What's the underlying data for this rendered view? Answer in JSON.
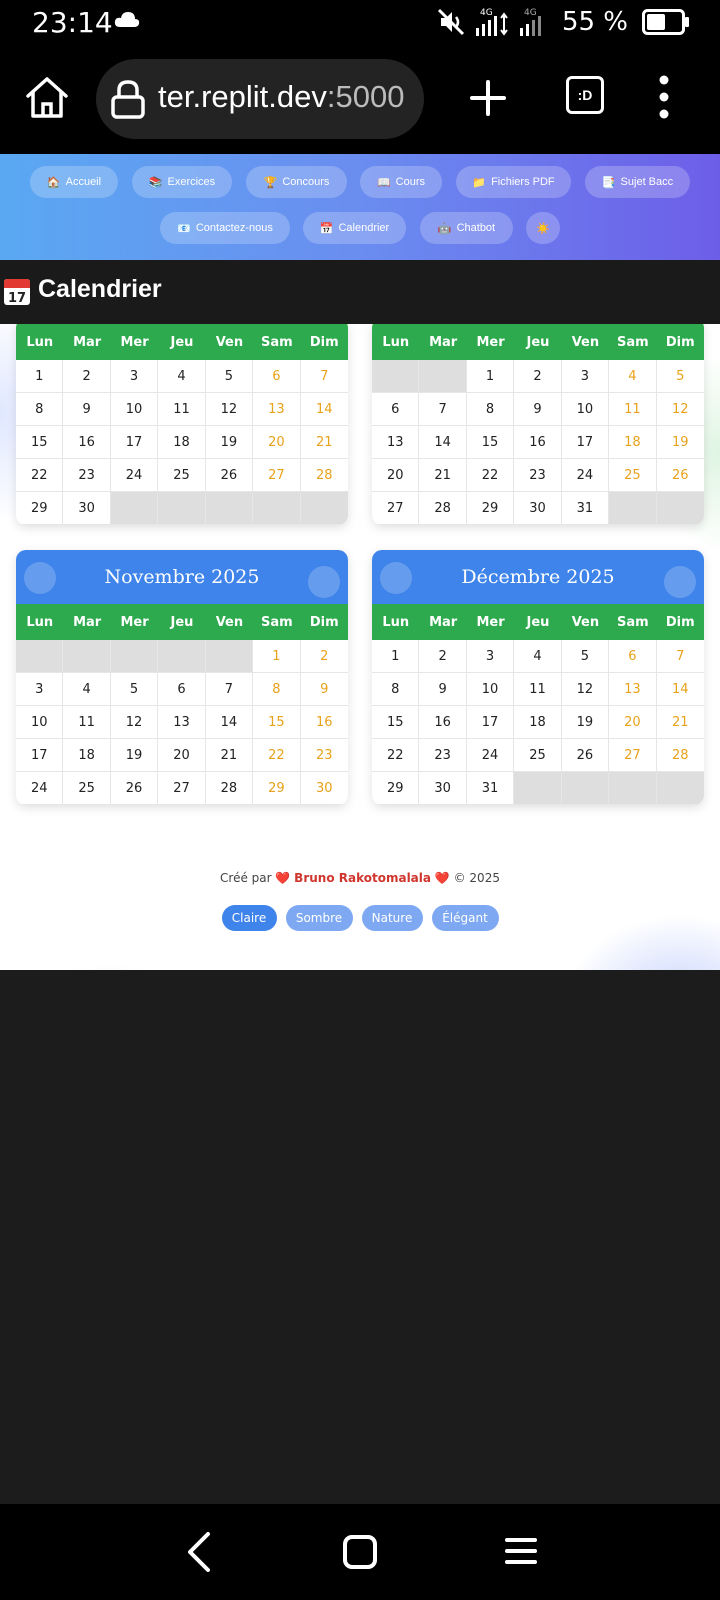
{
  "status_bar": {
    "time": "23:14",
    "network_1": "4G",
    "network_2": "4G",
    "battery_pct": "55 %",
    "battery_level": 0.55
  },
  "browser": {
    "url_main": "ter.replit.dev",
    "url_port": ":5000",
    "tabs_label": ":D"
  },
  "site_nav": {
    "items": [
      {
        "icon": "🏠",
        "label": "Accueil"
      },
      {
        "icon": "📚",
        "label": "Exercices"
      },
      {
        "icon": "🏆",
        "label": "Concours"
      },
      {
        "icon": "📖",
        "label": "Cours"
      },
      {
        "icon": "📁",
        "label": "Fichiers PDF"
      },
      {
        "icon": "📑",
        "label": "Sujet Bacc"
      },
      {
        "icon": "📧",
        "label": "Contactez-nous"
      },
      {
        "icon": "📅",
        "label": "Calendrier"
      },
      {
        "icon": "🤖",
        "label": "Chatbot"
      },
      {
        "icon": "☀️",
        "label": ""
      }
    ]
  },
  "page": {
    "title": "Calendrier"
  },
  "weekdays": [
    "Lun",
    "Mar",
    "Mer",
    "Jeu",
    "Ven",
    "Sam",
    "Dim"
  ],
  "calendars": [
    {
      "title": "",
      "lead_empty": 0,
      "days": 30
    },
    {
      "title": "",
      "lead_empty": 2,
      "days": 31
    },
    {
      "title": "Novembre 2025",
      "lead_empty": 5,
      "days": 30
    },
    {
      "title": "Décembre 2025",
      "lead_empty": 0,
      "days": 31
    }
  ],
  "footer": {
    "prefix": "Créé par",
    "heart": "❤️",
    "author": "Bruno Rakotomalala",
    "suffix": "© 2025",
    "themes": [
      "Claire",
      "Sombre",
      "Nature",
      "Élégant"
    ],
    "active_theme": "Claire"
  },
  "colors": {
    "nav_gradient_start": "#5aa8f2",
    "nav_gradient_end": "#6d5ee8",
    "calendar_header": "#3f84ea",
    "weekday_bar": "#2eaa4e",
    "weekend_text": "#e8a21b",
    "author_text": "#d0362e"
  }
}
